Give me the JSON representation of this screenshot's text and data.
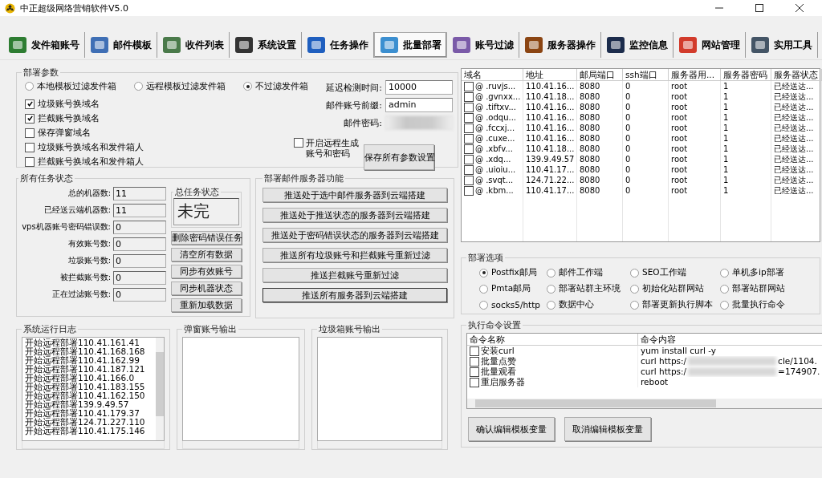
{
  "window": {
    "title": "中正超级网络营销软件V5.0"
  },
  "tabs": [
    {
      "label": "发件箱账号",
      "selected": false
    },
    {
      "label": "邮件模板",
      "selected": false
    },
    {
      "label": "收件列表",
      "selected": false
    },
    {
      "label": "系统设置",
      "selected": false
    },
    {
      "label": "任务操作",
      "selected": false
    },
    {
      "label": "批量部署",
      "selected": true
    },
    {
      "label": "账号过滤",
      "selected": false
    },
    {
      "label": "服务器操作",
      "selected": false
    },
    {
      "label": "监控信息",
      "selected": false
    },
    {
      "label": "网站管理",
      "selected": false
    },
    {
      "label": "实用工具",
      "selected": false
    }
  ],
  "deploy_params": {
    "title": "部署参数",
    "radios": [
      {
        "label": "本地模板过滤发件箱",
        "selected": false
      },
      {
        "label": "远程模板过滤发件箱",
        "selected": false
      },
      {
        "label": "不过滤发件箱",
        "selected": true
      }
    ],
    "checkboxes": [
      {
        "label": "垃圾账号换域名",
        "checked": true
      },
      {
        "label": "拦截账号换域名",
        "checked": true
      },
      {
        "label": "保存弹窗域名",
        "checked": false
      },
      {
        "label": "垃圾账号换域名和发件箱人",
        "checked": false
      },
      {
        "label": "拦截账号换域名和发件箱人",
        "checked": false
      }
    ],
    "fields": [
      {
        "kind": "text",
        "label": "延迟检测时间:",
        "value": "10000"
      },
      {
        "kind": "text",
        "label": "邮件账号前缀:",
        "value": "admin"
      },
      {
        "kind": "password",
        "label": "邮件密码:"
      }
    ],
    "remote_generate": {
      "label_1": "开启远程生成",
      "label_2": "账号和密码",
      "checked": false
    },
    "save_button": "保存所有参数设置"
  },
  "task_status": {
    "title": "所有任务状态",
    "stats": [
      {
        "label": "总的机器数:",
        "value": "11"
      },
      {
        "label": "已经送云端机器数:",
        "value": "11"
      },
      {
        "label": "vps机器账号密码错误数:",
        "value": "0"
      },
      {
        "label": "有效账号数:",
        "value": "0"
      },
      {
        "label": "垃圾账号数:",
        "value": "0"
      },
      {
        "label": "被拦截账号数:",
        "value": "0"
      },
      {
        "label": "正在过滤账号数:",
        "value": "0"
      }
    ],
    "overall": {
      "title": "总任务状态",
      "value": "未完"
    },
    "buttons": [
      "删除密码错误任务",
      "清空所有数据",
      "同步有效账号",
      "同步机器状态",
      "重新加载数据"
    ]
  },
  "server_functions": {
    "title": "部署邮件服务器功能",
    "buttons": [
      "推送处于选中邮件服务器到云端搭建",
      "推送处于推送状态的服务器到云端搭建",
      "推送处于密码错误状态的服务器到云端搭建",
      "推送所有垃圾账号和拦截账号重新过滤",
      "推送拦截账号重新过滤",
      "推送所有服务器到云端搭建"
    ]
  },
  "server_table": {
    "columns": [
      "域名",
      "地址",
      "邮局端口",
      "ssh端口",
      "服务器用...",
      "服务器密码",
      "服务器状态"
    ],
    "rows": [
      {
        "checked": false,
        "cells": [
          "@ .ruvjs...",
          "110.41.16...",
          "8080",
          "0",
          "root",
          "1",
          "已经送达..."
        ]
      },
      {
        "checked": false,
        "cells": [
          "@ .gvnxx...",
          "110.41.18...",
          "8080",
          "0",
          "root",
          "1",
          "已经送达..."
        ]
      },
      {
        "checked": false,
        "cells": [
          "@ .tiftxv...",
          "110.41.16...",
          "8080",
          "0",
          "root",
          "1",
          "已经送达..."
        ]
      },
      {
        "checked": false,
        "cells": [
          "@ .odqu...",
          "110.41.16...",
          "8080",
          "0",
          "root",
          "1",
          "已经送达..."
        ]
      },
      {
        "checked": false,
        "cells": [
          "@ .fccxj...",
          "110.41.16...",
          "8080",
          "0",
          "root",
          "1",
          "已经送达..."
        ]
      },
      {
        "checked": false,
        "cells": [
          "@ .cuxe...",
          "110.41.16...",
          "8080",
          "0",
          "root",
          "1",
          "已经送达..."
        ]
      },
      {
        "checked": false,
        "cells": [
          "@ .xbfv...",
          "110.41.18...",
          "8080",
          "0",
          "root",
          "1",
          "已经送达..."
        ]
      },
      {
        "checked": false,
        "cells": [
          "@ .xdq...",
          "139.9.49.57",
          "8080",
          "0",
          "root",
          "1",
          "已经送达..."
        ]
      },
      {
        "checked": false,
        "cells": [
          "@ .uioiu...",
          "110.41.17...",
          "8080",
          "0",
          "root",
          "1",
          "已经送达..."
        ]
      },
      {
        "checked": false,
        "cells": [
          "@ .svqt...",
          "124.71.22...",
          "8080",
          "0",
          "root",
          "1",
          "已经送达..."
        ]
      },
      {
        "checked": false,
        "cells": [
          "@ .kbm...",
          "110.41.17...",
          "8080",
          "0",
          "root",
          "1",
          "已经送达..."
        ]
      }
    ]
  },
  "deploy_options": {
    "title": "部署选项",
    "options": [
      {
        "label": "Postfix邮局",
        "selected": true
      },
      {
        "label": "邮件工作端",
        "selected": false
      },
      {
        "label": "SEO工作端",
        "selected": false
      },
      {
        "label": "单机多ip部署",
        "selected": false
      },
      {
        "label": "Pmta邮局",
        "selected": false
      },
      {
        "label": "部署站群主环境",
        "selected": false
      },
      {
        "label": "初始化站群网站",
        "selected": false
      },
      {
        "label": "部署站群网站",
        "selected": false
      },
      {
        "label": "socks5/http",
        "selected": false
      },
      {
        "label": "数据中心",
        "selected": false
      },
      {
        "label": "部署更新执行脚本",
        "selected": false
      },
      {
        "label": "批量执行命令",
        "selected": false
      }
    ]
  },
  "system_log": {
    "title": "系统运行日志",
    "lines": [
      "开始远程部署110.41.161.41",
      "开始远程部署110.41.168.168",
      "开始远程部署110.41.162.99",
      "开始远程部署110.41.187.121",
      "开始远程部署110.41.166.0",
      "开始远程部署110.41.183.155",
      "开始远程部署110.41.162.150",
      "开始远程部署139.9.49.57",
      "开始远程部署110.41.179.37",
      "开始远程部署124.71.227.110",
      "开始远程部署110.41.175.146"
    ]
  },
  "popup_output": {
    "title": "弹窗账号输出"
  },
  "junk_output": {
    "title": "垃圾箱账号输出"
  },
  "command_settings": {
    "title": "执行命令设置",
    "columns": [
      "命令名称",
      "命令内容"
    ],
    "rows": [
      {
        "checked": false,
        "name": "安装curl",
        "content": "yum install curl -y"
      },
      {
        "checked": false,
        "name": "批量点赞",
        "content": "curl https:/",
        "content_end": "cle/1104."
      },
      {
        "checked": false,
        "name": "批量观看",
        "content": "curl  https:/",
        "content_end": "=174907."
      },
      {
        "checked": false,
        "name": "重启服务器",
        "content": "reboot"
      }
    ],
    "buttons": [
      "确认编辑模板变量",
      "取消编辑模板变量"
    ]
  }
}
